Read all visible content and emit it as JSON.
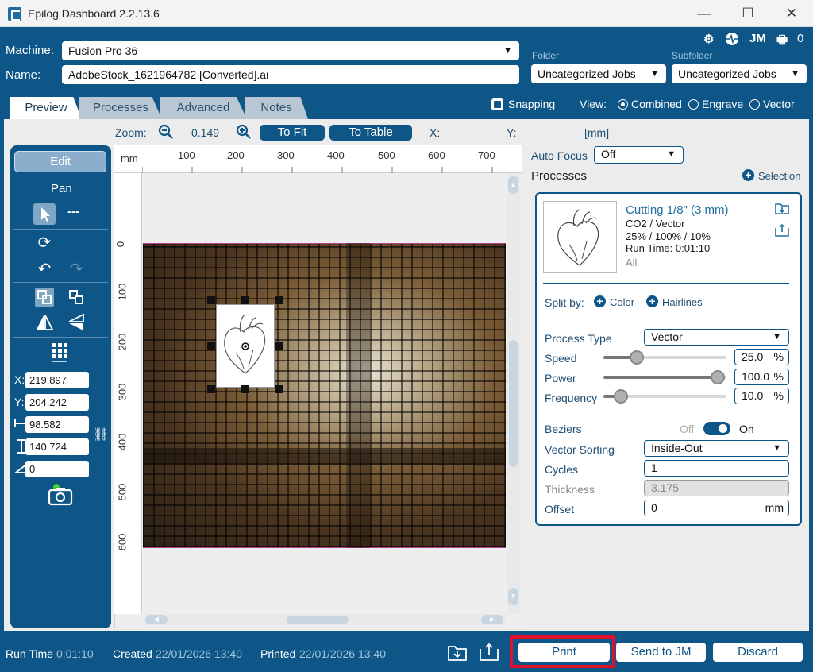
{
  "window": {
    "title": "Epilog Dashboard 2.2.13.6",
    "minimize": "—",
    "maximize": "☐",
    "close": "✕"
  },
  "header": {
    "machine_label": "Machine:",
    "machine_value": "Fusion Pro 36",
    "name_label": "Name:",
    "name_value": "AdobeStock_1621964782 [Converted].ai",
    "folder_label": "Folder",
    "folder_value": "Uncategorized Jobs",
    "subfolder_label": "Subfolder",
    "subfolder_value": "Uncategorized Jobs",
    "jm_label": "JM",
    "queue_count": "0"
  },
  "tabs": [
    {
      "label": "Preview",
      "active": true
    },
    {
      "label": "Processes",
      "active": false
    },
    {
      "label": "Advanced",
      "active": false
    },
    {
      "label": "Notes",
      "active": false
    }
  ],
  "view": {
    "snapping_label": "Snapping",
    "snapping_checked": true,
    "view_label": "View:",
    "options": [
      "Combined",
      "Engrave",
      "Vector"
    ],
    "selected": "Combined"
  },
  "toolbar": {
    "zoom_label": "Zoom:",
    "zoom_value": "0.149",
    "to_fit": "To Fit",
    "to_table": "To Table",
    "x_label": "X:",
    "y_label": "Y:",
    "unit": "[mm]"
  },
  "tools": {
    "edit": "Edit",
    "pan": "Pan",
    "dashes": "---",
    "x_label": "X:",
    "x_value": "219.897",
    "y_label": "Y:",
    "y_value": "204.242",
    "w_value": "98.582",
    "h_value": "140.724",
    "angle_value": "0"
  },
  "ruler": {
    "unit": "mm",
    "top": [
      "100",
      "200",
      "300",
      "400",
      "500",
      "600",
      "700"
    ],
    "left": [
      "0",
      "100",
      "200",
      "300",
      "400",
      "500",
      "600"
    ]
  },
  "right": {
    "autofocus_label": "Auto Focus",
    "autofocus_value": "Off",
    "processes_label": "Processes",
    "selection_label": "Selection",
    "process": {
      "name": "Cutting 1/8\" (3 mm)",
      "type_line": "CO2 / Vector",
      "settings_line": "25%  /  100%  /  10%",
      "runtime_line": "Run Time: 0:01:10",
      "filter": "All"
    },
    "split_by_label": "Split by:",
    "split_color": "Color",
    "split_hairlines": "Hairlines",
    "process_type_label": "Process Type",
    "process_type_value": "Vector",
    "speed_label": "Speed",
    "speed_value": "25.0",
    "speed_pct": 25,
    "power_label": "Power",
    "power_value": "100.0",
    "power_pct": 100,
    "frequency_label": "Frequency",
    "frequency_value": "10.0",
    "frequency_pct": 10,
    "percent": "%",
    "beziers_label": "Beziers",
    "beziers_off": "Off",
    "beziers_on": "On",
    "vector_sorting_label": "Vector Sorting",
    "vector_sorting_value": "Inside-Out",
    "cycles_label": "Cycles",
    "cycles_value": "1",
    "thickness_label": "Thickness",
    "thickness_value": "3.175",
    "offset_label": "Offset",
    "offset_value": "0",
    "offset_unit": "mm"
  },
  "footer": {
    "runtime_label": "Run Time",
    "runtime_value": "0:01:10",
    "created_label": "Created",
    "created_value": "22/01/2026 13:40",
    "printed_label": "Printed",
    "printed_value": "22/01/2026 13:40",
    "print": "Print",
    "send_to_jm": "Send to JM",
    "discard": "Discard"
  },
  "colors": {
    "brand": "#0e5687",
    "highlight": "#e0102a"
  }
}
